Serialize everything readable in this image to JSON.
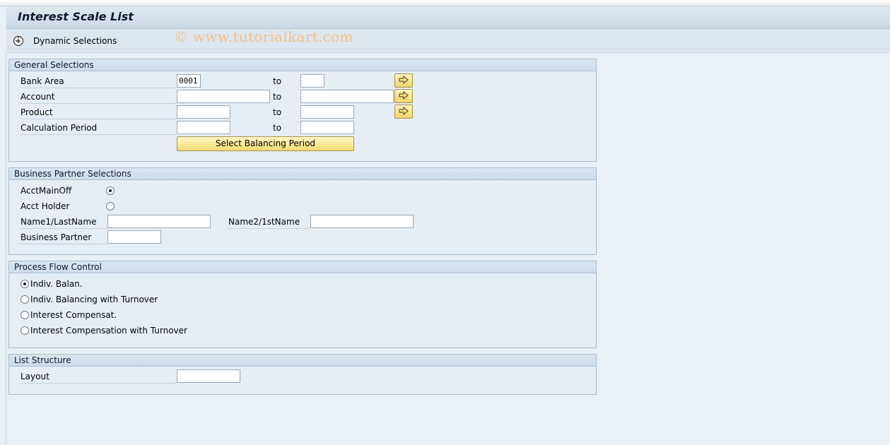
{
  "title": "Interest Scale List",
  "watermark": "© www.tutorialkart.com",
  "toolbar": {
    "dynamic_selections_label": "Dynamic Selections",
    "dynamic_selections_icon": "dynamic-selections-icon"
  },
  "general": {
    "header": "General Selections",
    "to_label": "to",
    "rows": [
      {
        "label": "Bank Area",
        "from": "0001",
        "to": ""
      },
      {
        "label": "Account",
        "from": "",
        "to": ""
      },
      {
        "label": "Product",
        "from": "",
        "to": ""
      },
      {
        "label": "Calculation Period",
        "from": "",
        "to": ""
      }
    ],
    "balancing_button": "Select Balancing Period",
    "multi_select_icon": "arrow-right-icon"
  },
  "bp": {
    "header": "Business Partner Selections",
    "radios": [
      {
        "label": "AcctMainOff",
        "selected": true
      },
      {
        "label": "Acct Holder",
        "selected": false
      }
    ],
    "name1_label": "Name1/LastName",
    "name1_value": "",
    "name2_label": "Name2/1stName",
    "name2_value": "",
    "partner_label": "Business Partner",
    "partner_value": ""
  },
  "process": {
    "header": "Process Flow Control",
    "options": [
      {
        "label": "Indiv. Balan.",
        "selected": true
      },
      {
        "label": "Indiv. Balancing with Turnover",
        "selected": false
      },
      {
        "label": "Interest Compensat.",
        "selected": false
      },
      {
        "label": "Interest Compensation with Turnover",
        "selected": false
      }
    ]
  },
  "list": {
    "header": "List Structure",
    "layout_label": "Layout",
    "layout_value": ""
  }
}
